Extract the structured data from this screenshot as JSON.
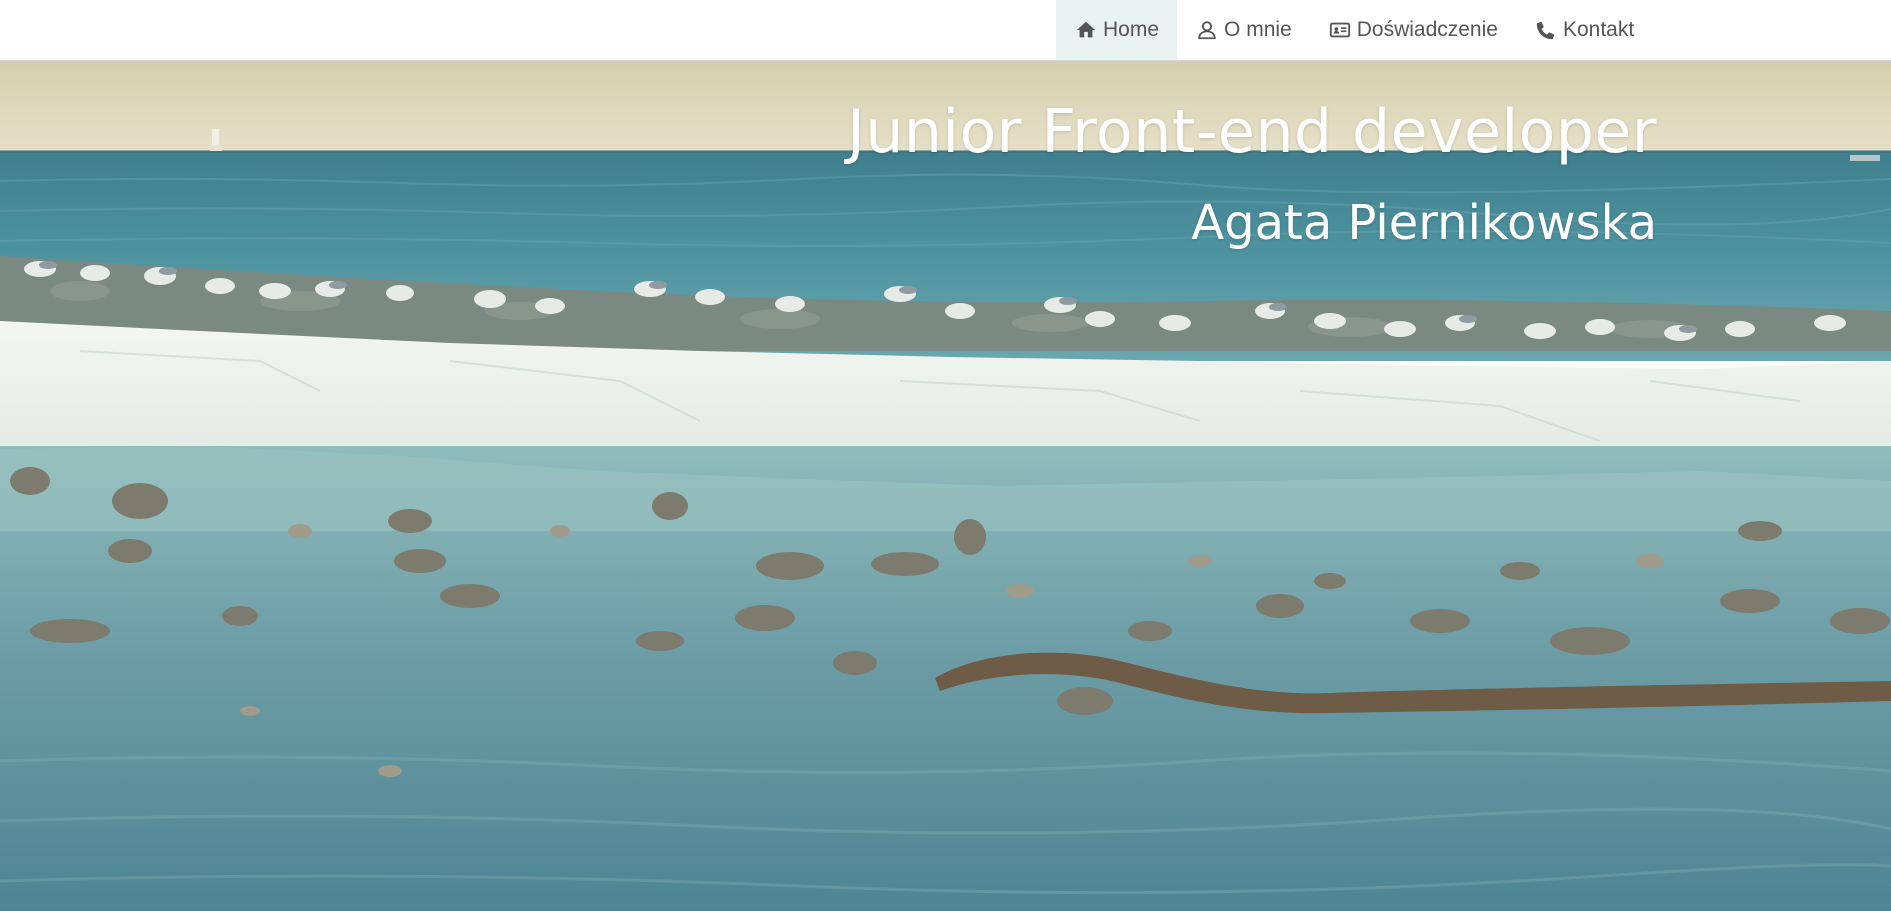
{
  "nav": {
    "items": [
      {
        "label": "Home",
        "icon": "home-icon",
        "active": true
      },
      {
        "label": "O mnie",
        "icon": "user-icon",
        "active": false
      },
      {
        "label": "Doświadczenie",
        "icon": "id-card-icon",
        "active": false
      },
      {
        "label": "Kontakt",
        "icon": "phone-icon",
        "active": false
      }
    ]
  },
  "hero": {
    "title": "Junior Front-end developer",
    "subtitle": "Agata Piernikowska",
    "background": "photo-sea-shore-seagulls-ice"
  },
  "colors": {
    "nav_background": "#ffffff",
    "nav_text": "#555555",
    "nav_active_background": "#eaf1f1",
    "hero_text": "#ffffff",
    "sky": "#dcd5b8",
    "sea": "#4f8c99",
    "ice": "#eef2ee",
    "shallow_water": "#6fa3ab"
  }
}
